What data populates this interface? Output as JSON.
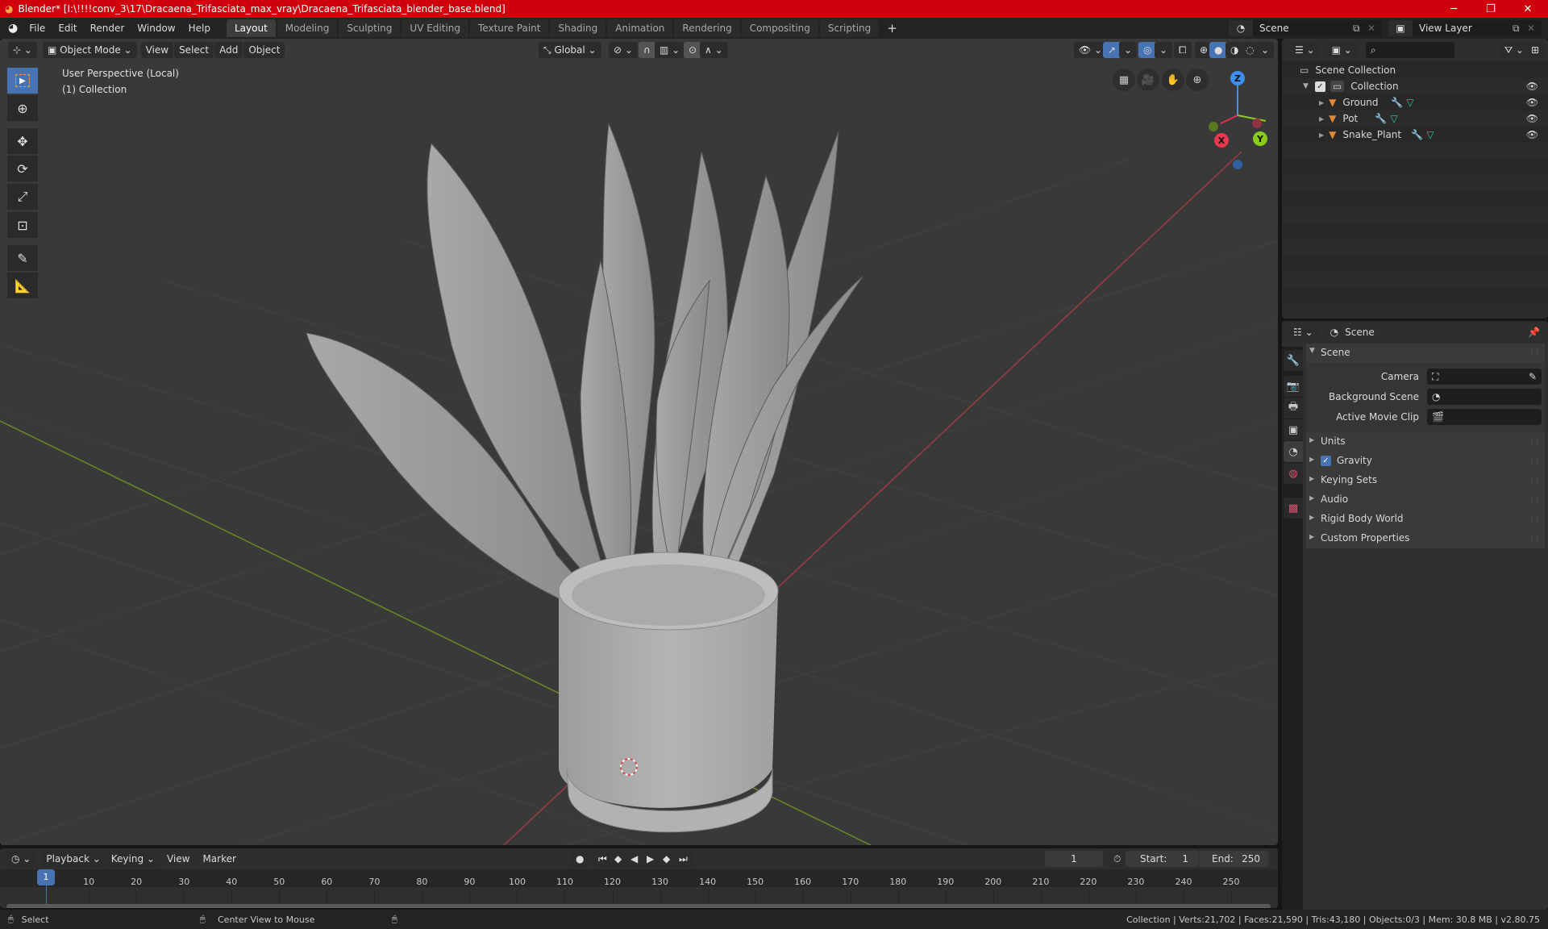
{
  "window": {
    "title": "Blender* [I:\\!!!!conv_3\\17\\Dracaena_Trifasciata_max_vray\\Dracaena_Trifasciata_blender_base.blend]",
    "controls": {
      "minimize": "─",
      "maximize": "❐",
      "close": "✕"
    }
  },
  "menu": [
    "File",
    "Edit",
    "Render",
    "Window",
    "Help"
  ],
  "workspaces": [
    {
      "label": "Layout",
      "active": true
    },
    {
      "label": "Modeling"
    },
    {
      "label": "Sculpting"
    },
    {
      "label": "UV Editing"
    },
    {
      "label": "Texture Paint"
    },
    {
      "label": "Shading"
    },
    {
      "label": "Animation"
    },
    {
      "label": "Rendering"
    },
    {
      "label": "Compositing"
    },
    {
      "label": "Scripting"
    }
  ],
  "add_workspace": "+",
  "scene_selector": {
    "value": "Scene"
  },
  "view_layer_selector": {
    "value": "View Layer"
  },
  "viewport": {
    "mode": "Object Mode",
    "menus": [
      "View",
      "Select",
      "Add",
      "Object"
    ],
    "transform_orientation": "Global",
    "overlay_title": "User Perspective (Local)",
    "overlay_collection": "(1) Collection",
    "gizmo": {
      "x": "X",
      "y": "Y",
      "z": "Z"
    },
    "colors": {
      "x_axis": "#9b3a44",
      "y_axis": "#6b8a24",
      "grid": "#444444",
      "background": "#393939",
      "mesh": "#b8b8b8"
    }
  },
  "toolbar": {
    "tools": [
      "select-box",
      "cursor",
      "move",
      "rotate",
      "scale",
      "transform",
      "annotate",
      "measure"
    ]
  },
  "outliner": {
    "search_placeholder": "",
    "root": "Scene Collection",
    "collection": "Collection",
    "objects": [
      {
        "name": "Ground"
      },
      {
        "name": "Pot"
      },
      {
        "name": "Snake_Plant"
      }
    ]
  },
  "properties": {
    "header": "Scene",
    "section_scene": "Scene",
    "fields": [
      {
        "label": "Camera",
        "value": ""
      },
      {
        "label": "Background Scene",
        "value": ""
      },
      {
        "label": "Active Movie Clip",
        "value": ""
      }
    ],
    "panels": [
      {
        "label": "Units"
      },
      {
        "label": "Gravity",
        "checkbox": true
      },
      {
        "label": "Keying Sets"
      },
      {
        "label": "Audio"
      },
      {
        "label": "Rigid Body World"
      },
      {
        "label": "Custom Properties"
      }
    ]
  },
  "timeline": {
    "menus": [
      "Playback",
      "Keying",
      "View",
      "Marker"
    ],
    "current_frame": "1",
    "start_label": "Start:",
    "start": "1",
    "end_label": "End:",
    "end": "250",
    "ticks": [
      "10",
      "20",
      "30",
      "40",
      "50",
      "60",
      "70",
      "80",
      "90",
      "100",
      "110",
      "120",
      "130",
      "140",
      "150",
      "160",
      "170",
      "180",
      "190",
      "200",
      "210",
      "220",
      "230",
      "240",
      "250"
    ],
    "playhead": "1"
  },
  "statusbar": {
    "left_action": "Select",
    "middle_action": "Center View to Mouse",
    "stats": "Collection | Verts:21,702 | Faces:21,590 | Tris:43,180 | Objects:0/3 | Mem: 30.8 MB | v2.80.75"
  }
}
